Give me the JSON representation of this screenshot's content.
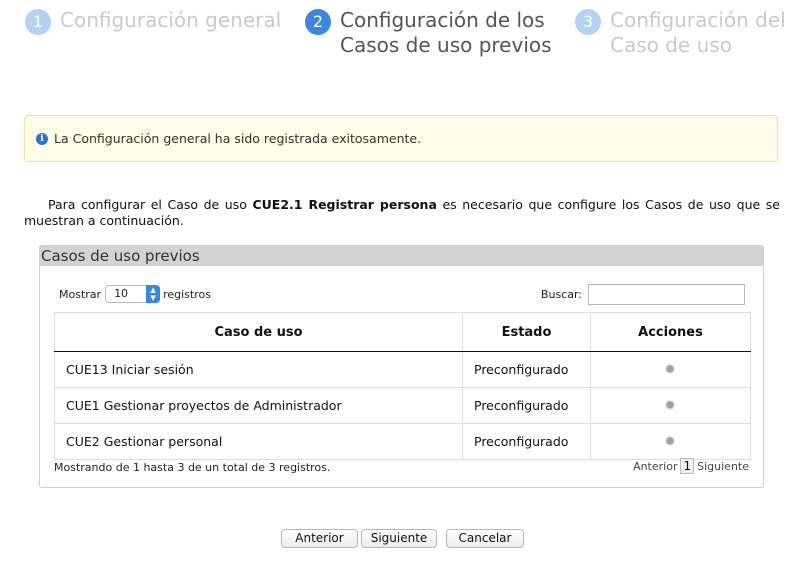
{
  "wizard": {
    "steps": [
      {
        "number": "1",
        "label": "Configuración general"
      },
      {
        "number": "2",
        "label": "Configuración de los Casos de uso previos"
      },
      {
        "number": "3",
        "label": "Configuración del Caso de uso"
      }
    ],
    "active_step": 2
  },
  "alert": {
    "icon": "info-icon",
    "message": "La Configuración general ha sido registrada exitosamente."
  },
  "intro": {
    "text_before": "Para configurar el Caso de uso ",
    "case_name": "CUE2.1 Registrar persona",
    "text_after": " es necesario que configure los Casos de uso que se muestran a continuación."
  },
  "panel": {
    "title": "Casos de uso previos",
    "length": {
      "prefix": "Mostrar",
      "value": "10",
      "suffix": "registros"
    },
    "search": {
      "label": "Buscar:",
      "value": ""
    },
    "columns": [
      "Caso de uso",
      "Estado",
      "Acciones"
    ],
    "rows": [
      {
        "caso": "CUE13 Iniciar sesión",
        "estado": "Preconfigurado",
        "accion_icon": "gear-icon"
      },
      {
        "caso": "CUE1 Gestionar proyectos de Administrador",
        "estado": "Preconfigurado",
        "accion_icon": "gear-icon"
      },
      {
        "caso": "CUE2 Gestionar personal",
        "estado": "Preconfigurado",
        "accion_icon": "gear-icon"
      }
    ],
    "info": "Mostrando de 1 hasta 3 de un total de 3 registros.",
    "pager": {
      "prev": "Anterior",
      "page": "1",
      "next": "Siguiente"
    }
  },
  "footer": {
    "prev_label": "Anterior",
    "next_label": "Siguiente",
    "cancel_label": "Cancelar"
  },
  "colors": {
    "accent": "#3b86e0",
    "alert_bg": "#fefbe6",
    "panel_header": "#d3d3d3"
  }
}
